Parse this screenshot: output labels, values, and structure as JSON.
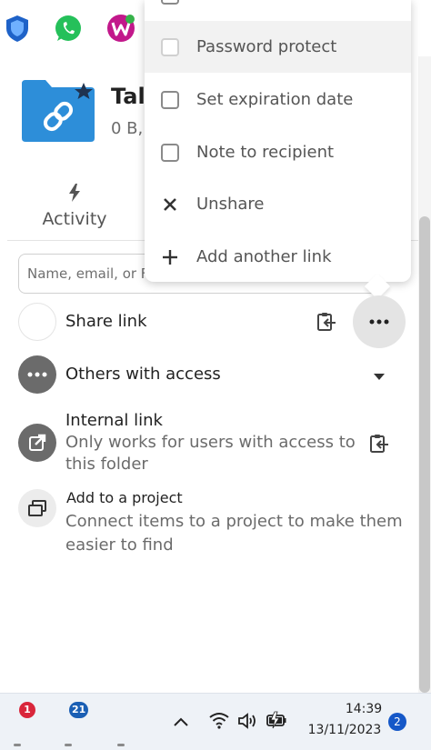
{
  "header": {
    "title": "Tal",
    "subtitle": "0 B,"
  },
  "tabs": {
    "activity_label": "Activity"
  },
  "search": {
    "placeholder": "Name, email, or F"
  },
  "share_link": {
    "label": "Share link"
  },
  "others_access": {
    "label": "Others with access"
  },
  "internal_link": {
    "title": "Internal link",
    "line1": "Only works for users with access to",
    "line2": "this folder"
  },
  "project": {
    "title": "Add to a project",
    "line1": "Connect items to a project to make them",
    "line2": "easier to find"
  },
  "menu": {
    "items": [
      {
        "label": "Password protect",
        "type": "checkbox"
      },
      {
        "label": "Set expiration date",
        "type": "checkbox"
      },
      {
        "label": "Note to recipient",
        "type": "checkbox"
      },
      {
        "label": "Unshare",
        "type": "icon",
        "icon": "close-icon"
      },
      {
        "label": "Add another link",
        "type": "icon",
        "icon": "plus-icon"
      }
    ]
  },
  "taskbar": {
    "app1_badge": "1",
    "app2_badge": "21",
    "time": "14:39",
    "date": "13/11/2023",
    "notifications": "2"
  },
  "colors": {
    "folder": "#2d8ed9",
    "accent": "#1558c8",
    "avatar_dark": "#6b6b6b",
    "avatar_light": "#ececec"
  }
}
